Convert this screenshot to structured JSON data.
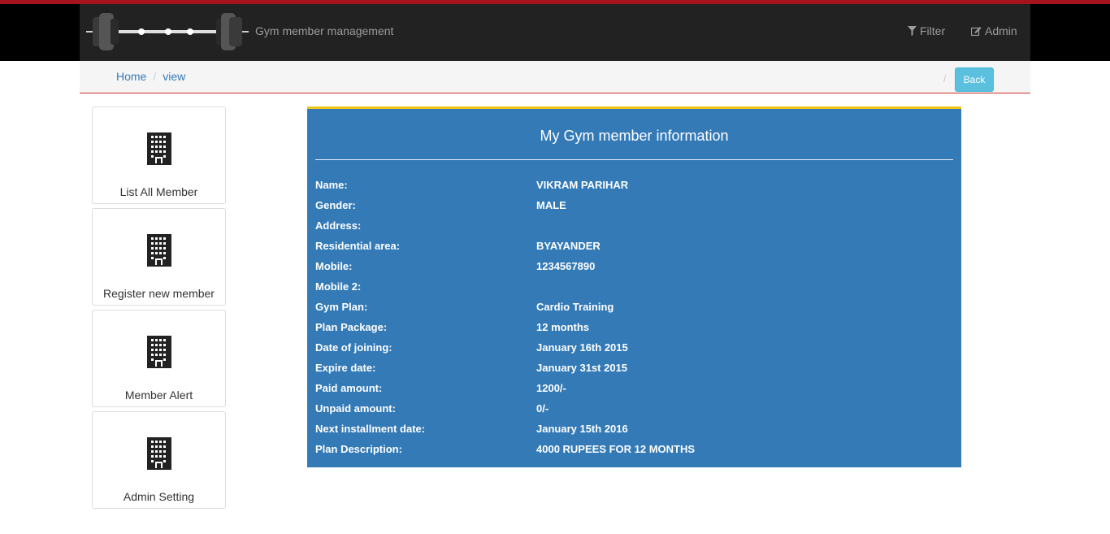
{
  "navbar": {
    "brand": "Gym member management",
    "filter_label": "Filter",
    "admin_label": "Admin"
  },
  "breadcrumb": {
    "home": "Home",
    "current": "view",
    "separator": "/",
    "back_label": "Back"
  },
  "sidebar": {
    "items": [
      {
        "label": "List All Member"
      },
      {
        "label": "Register new member"
      },
      {
        "label": "Member Alert"
      },
      {
        "label": "Admin Setting"
      }
    ]
  },
  "panel": {
    "title": "My Gym member information",
    "fields": [
      {
        "label": "Name:",
        "value": "VIKRAM PARIHAR"
      },
      {
        "label": "Gender:",
        "value": "MALE"
      },
      {
        "label": "Address:",
        "value": ""
      },
      {
        "label": "Residential area:",
        "value": "BYAYANDER"
      },
      {
        "label": "Mobile:",
        "value": "1234567890"
      },
      {
        "label": "Mobile 2:",
        "value": ""
      },
      {
        "label": "Gym Plan:",
        "value": "Cardio Training"
      },
      {
        "label": "Plan Package:",
        "value": "12 months"
      },
      {
        "label": "Date of joining:",
        "value": "January 16th 2015"
      },
      {
        "label": "Expire date:",
        "value": "January 31st 2015"
      },
      {
        "label": "Paid amount:",
        "value": "1200/-"
      },
      {
        "label": "Unpaid amount:",
        "value": "0/-"
      },
      {
        "label": "Next installment date:",
        "value": "January 15th 2016"
      },
      {
        "label": "Plan Description:",
        "value": "4000 RUPEES FOR 12 MONTHS"
      }
    ]
  },
  "icons": {
    "logo": "barbell-logo",
    "filter": "filter-icon",
    "admin": "edit-icon",
    "tile": "building-icon"
  },
  "colors": {
    "accent_red": "#a3141c",
    "panel_blue": "#337ab7",
    "panel_top_border": "#f0c419",
    "back_button": "#5bc0de"
  }
}
